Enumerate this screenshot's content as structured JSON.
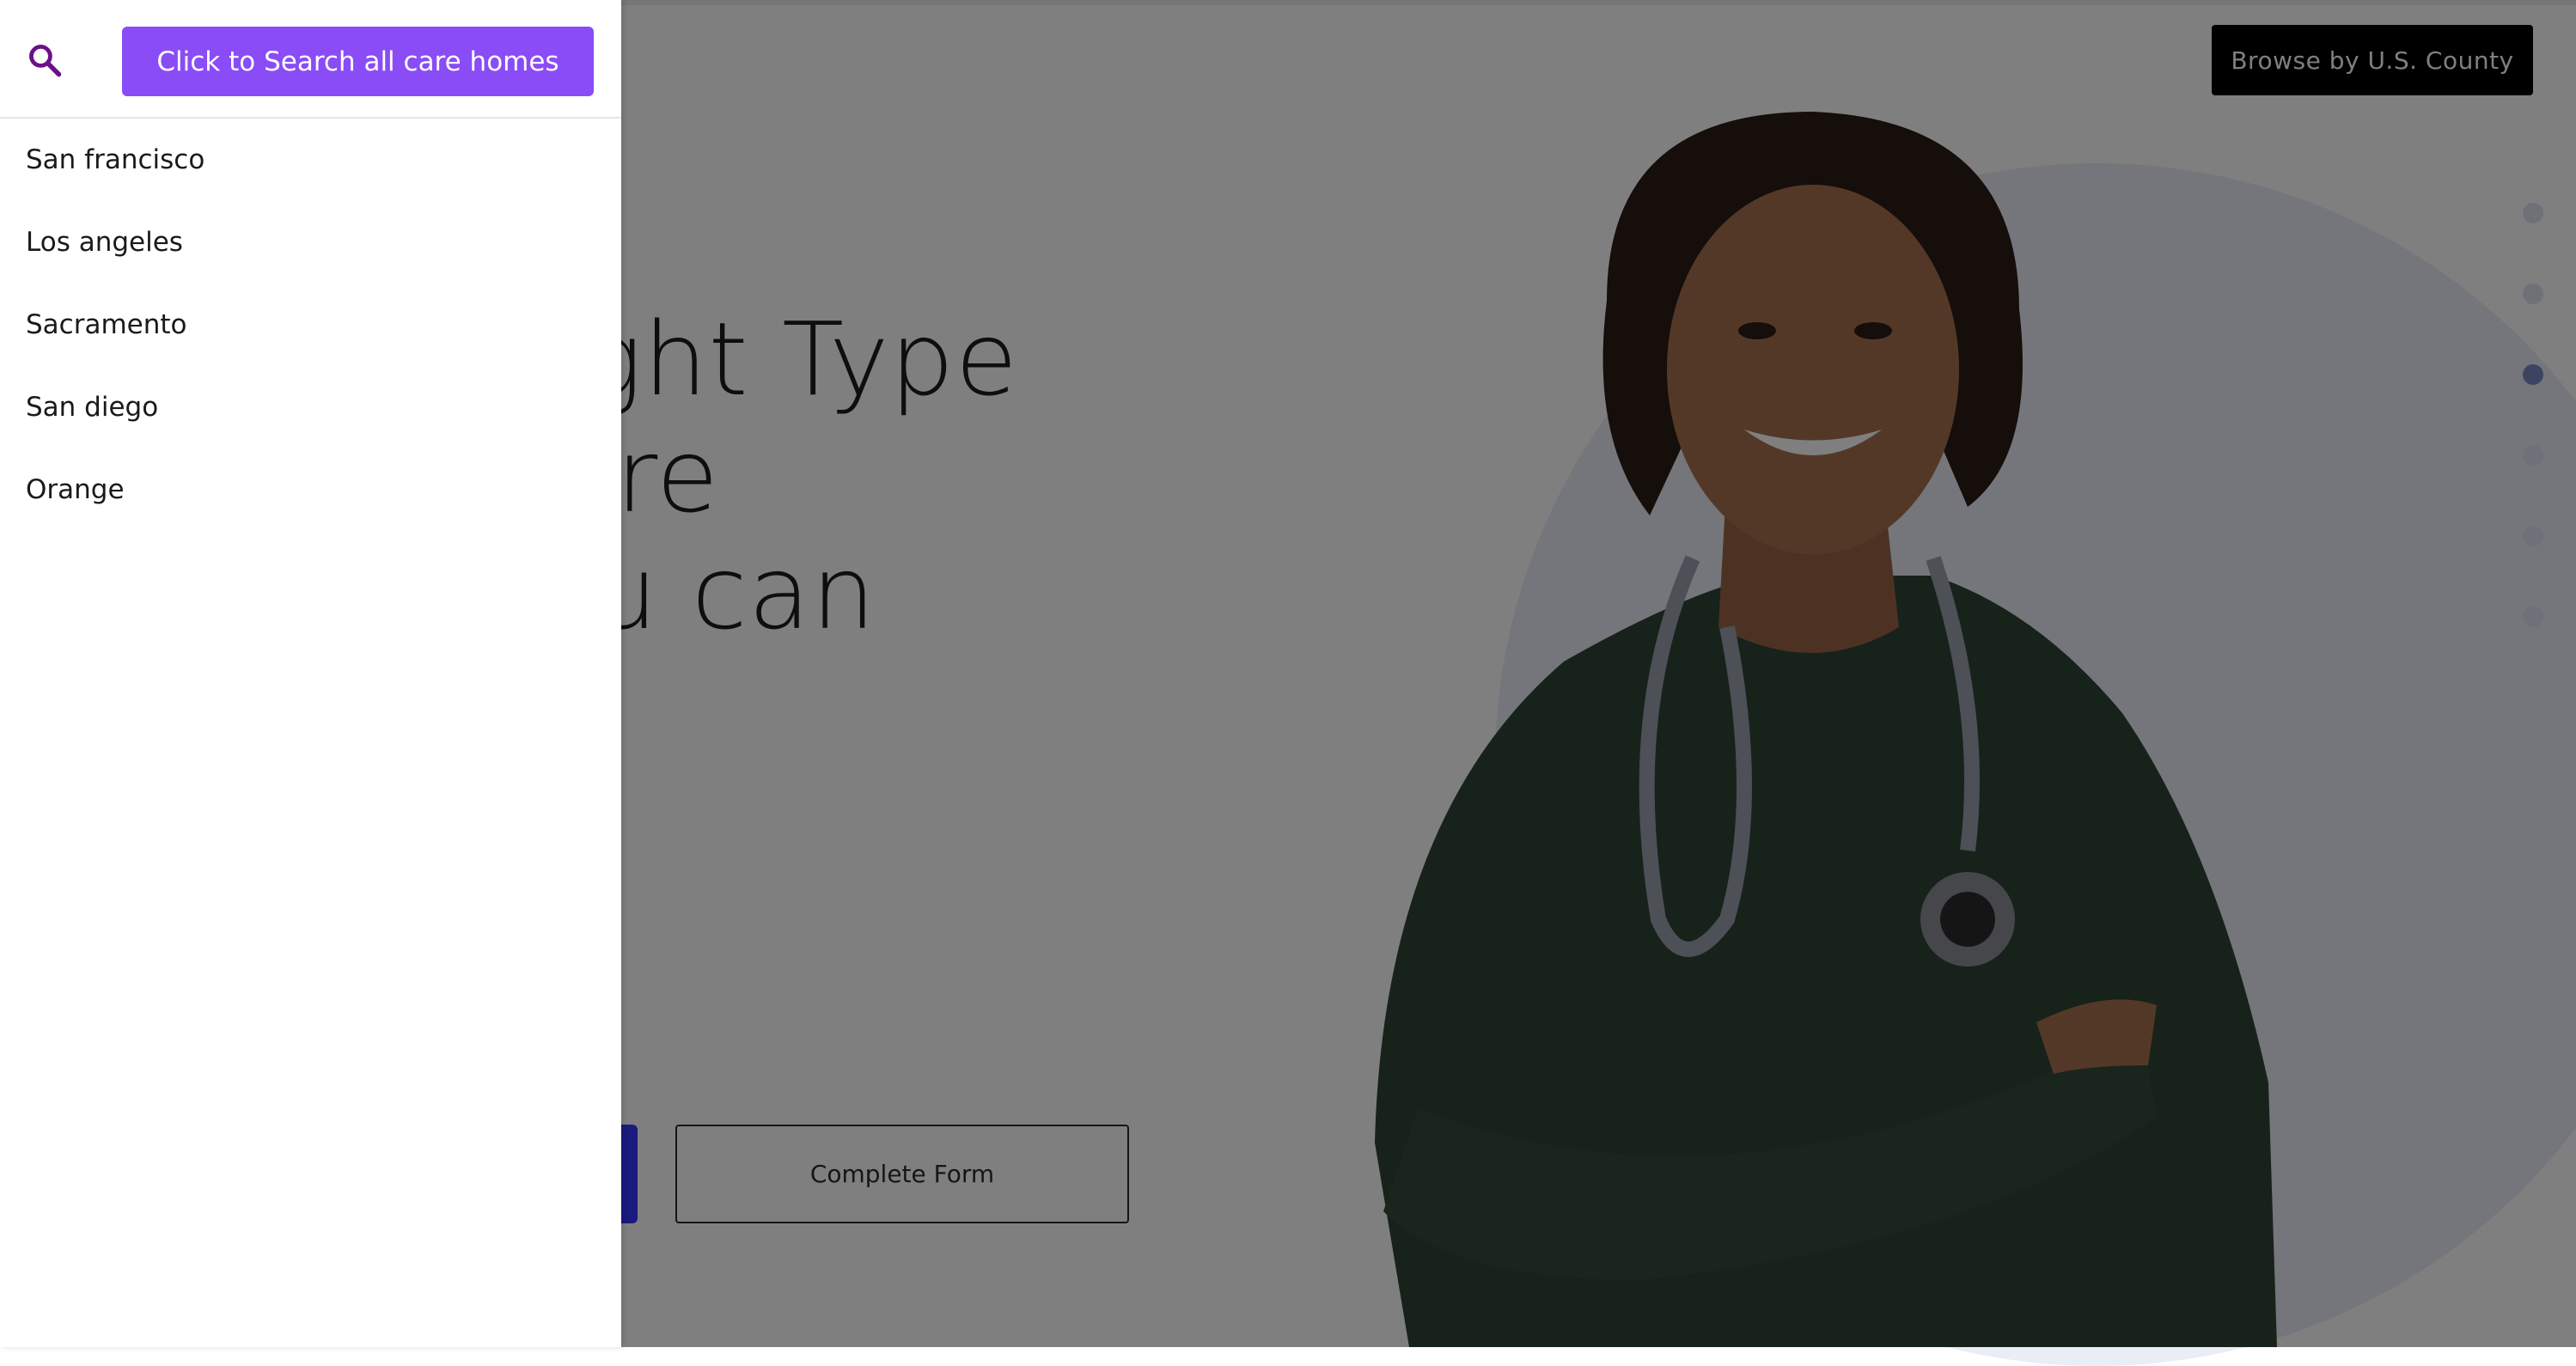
{
  "search": {
    "button_label": "Click to Search all care homes",
    "cities": [
      "San francisco",
      "Los angeles",
      "Sacramento",
      "San diego",
      "Orange"
    ]
  },
  "header": {
    "browse_label": "Browse by U.S. County"
  },
  "hero": {
    "heading_lines": [
      "Right Type",
      "Care",
      "You can"
    ],
    "secondary_button_label": "Complete Form"
  },
  "colors": {
    "accent": "#8a4cf6",
    "primary_cta": "#3535ff",
    "search_icon": "#6b0f8a"
  },
  "icons": {
    "search": "search-icon"
  }
}
